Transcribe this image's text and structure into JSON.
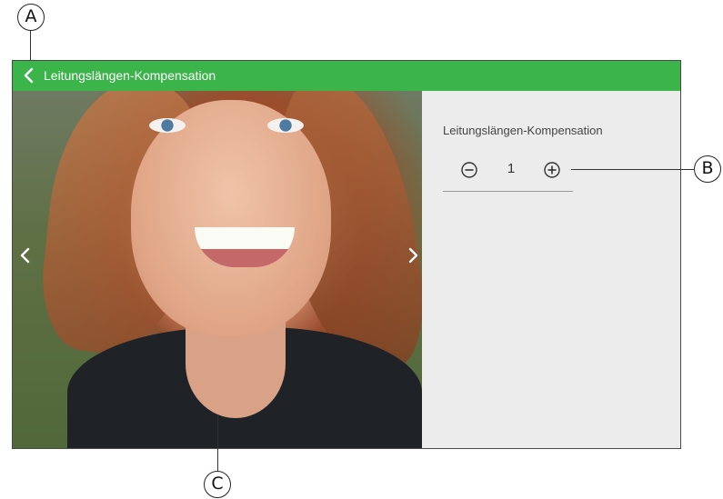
{
  "callouts": {
    "a": "A",
    "b": "B",
    "c": "C"
  },
  "titlebar": {
    "title": "Leitungslängen-Kompensation",
    "color": "#3bb54a"
  },
  "icons": {
    "back": "chevron-left-icon",
    "prev": "chevron-left-icon",
    "next": "chevron-right-icon",
    "decrease": "minus-circle-icon",
    "increase": "plus-circle-icon"
  },
  "settings": {
    "label": "Leitungslängen-Kompensation",
    "value": "1"
  }
}
